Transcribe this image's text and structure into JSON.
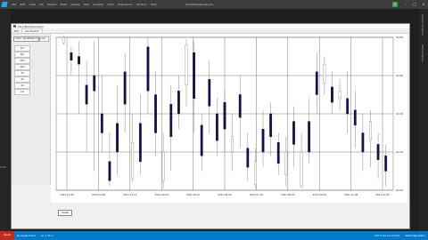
{
  "ide": {
    "title": "StockMarketAnalysis",
    "menu": [
      "File",
      "Edit",
      "View",
      "Git",
      "Project",
      "Build",
      "Debug",
      "Test",
      "Analyze",
      "Tools",
      "Extensions",
      "Window",
      "Help"
    ],
    "profile_initial": "A",
    "left_marker": "0:00",
    "right_tabs": [
      "Solution Explorer",
      "Team Explorer"
    ]
  },
  "app": {
    "title": "StockMarketAnalysis",
    "tabs": [
      "File",
      "Candlestick"
    ],
    "active_tab": "Candlestick",
    "symbol": "ticker: stockData.csv",
    "count_value": "1.00",
    "timeframes": [
      "1m",
      "5m",
      "15m",
      "30m",
      "1h",
      "4h",
      "1d",
      "1w"
    ],
    "close_label": "Close"
  },
  "status": {
    "ready_label": "Ready",
    "items": [
      "No issues found",
      "Ln: 1  Ch: 1"
    ],
    "right_items": [
      "Add to Source Control",
      "Select Repository"
    ]
  },
  "chart_data": {
    "type": "candlestick",
    "y_ticks": [
      "22.80",
      "22.60",
      "22.40",
      "22.20",
      "22.00"
    ],
    "x_ticks": [
      "2021-01-05",
      "2021-02-08",
      "2021-03-10",
      "2021-04-09",
      "2021-05-10",
      "2021-06-09",
      "2021-07-09",
      "2021-08-09",
      "2021-09-08",
      "2021-10-08",
      "2021-11-05"
    ],
    "ylim": [
      22.0,
      22.8
    ],
    "grid": true,
    "candles": [
      {
        "o": 22.8,
        "c": 22.77,
        "h": 22.81,
        "l": 22.76,
        "bull": false
      },
      {
        "o": 22.72,
        "c": 22.68,
        "h": 22.75,
        "l": 22.6,
        "bull": true
      },
      {
        "o": 22.7,
        "c": 22.66,
        "h": 22.78,
        "l": 22.4,
        "bull": true
      },
      {
        "o": 22.55,
        "c": 22.45,
        "h": 22.68,
        "l": 22.2,
        "bull": true
      },
      {
        "o": 22.6,
        "c": 22.52,
        "h": 22.78,
        "l": 22.1,
        "bull": true
      },
      {
        "o": 22.4,
        "c": 22.3,
        "h": 22.6,
        "l": 22.2,
        "bull": true
      },
      {
        "o": 22.15,
        "c": 22.05,
        "h": 22.3,
        "l": 22.02,
        "bull": true
      },
      {
        "o": 22.35,
        "c": 22.2,
        "h": 22.55,
        "l": 22.08,
        "bull": true
      },
      {
        "o": 22.62,
        "c": 22.45,
        "h": 22.72,
        "l": 22.3,
        "bull": true
      },
      {
        "o": 22.25,
        "c": 22.06,
        "h": 22.4,
        "l": 22.04,
        "bull": false
      },
      {
        "o": 22.35,
        "c": 22.15,
        "h": 22.5,
        "l": 22.08,
        "bull": true
      },
      {
        "o": 22.75,
        "c": 22.52,
        "h": 22.8,
        "l": 22.4,
        "bull": true
      },
      {
        "o": 22.5,
        "c": 22.3,
        "h": 22.62,
        "l": 22.18,
        "bull": true
      },
      {
        "o": 22.2,
        "c": 22.05,
        "h": 22.3,
        "l": 22.01,
        "bull": false
      },
      {
        "o": 22.45,
        "c": 22.28,
        "h": 22.55,
        "l": 22.1,
        "bull": true
      },
      {
        "o": 22.52,
        "c": 22.4,
        "h": 22.6,
        "l": 22.32,
        "bull": true
      },
      {
        "o": 22.76,
        "c": 22.55,
        "h": 22.79,
        "l": 22.44,
        "bull": false
      },
      {
        "o": 22.72,
        "c": 22.48,
        "h": 22.78,
        "l": 22.3,
        "bull": true
      },
      {
        "o": 22.34,
        "c": 22.18,
        "h": 22.4,
        "l": 22.1,
        "bull": true
      },
      {
        "o": 22.58,
        "c": 22.44,
        "h": 22.68,
        "l": 22.3,
        "bull": true
      },
      {
        "o": 22.4,
        "c": 22.26,
        "h": 22.48,
        "l": 22.18,
        "bull": true
      },
      {
        "o": 22.46,
        "c": 22.32,
        "h": 22.52,
        "l": 22.2,
        "bull": true
      },
      {
        "o": 22.28,
        "c": 22.2,
        "h": 22.4,
        "l": 22.1,
        "bull": false
      },
      {
        "o": 22.5,
        "c": 22.38,
        "h": 22.6,
        "l": 22.22,
        "bull": true
      },
      {
        "o": 22.22,
        "c": 22.12,
        "h": 22.3,
        "l": 22.05,
        "bull": true
      },
      {
        "o": 22.15,
        "c": 22.03,
        "h": 22.22,
        "l": 22.01,
        "bull": false
      },
      {
        "o": 22.32,
        "c": 22.2,
        "h": 22.42,
        "l": 22.12,
        "bull": true
      },
      {
        "o": 22.4,
        "c": 22.28,
        "h": 22.46,
        "l": 22.18,
        "bull": true
      },
      {
        "o": 22.25,
        "c": 22.14,
        "h": 22.3,
        "l": 22.08,
        "bull": true
      },
      {
        "o": 22.2,
        "c": 22.08,
        "h": 22.28,
        "l": 22.02,
        "bull": false
      },
      {
        "o": 22.36,
        "c": 22.24,
        "h": 22.44,
        "l": 22.12,
        "bull": true
      },
      {
        "o": 22.2,
        "c": 22.02,
        "h": 22.3,
        "l": 22.01,
        "bull": false
      },
      {
        "o": 22.36,
        "c": 22.2,
        "h": 22.48,
        "l": 22.14,
        "bull": true
      },
      {
        "o": 22.62,
        "c": 22.5,
        "h": 22.72,
        "l": 22.4,
        "bull": true
      },
      {
        "o": 22.66,
        "c": 22.56,
        "h": 22.7,
        "l": 22.5,
        "bull": false
      },
      {
        "o": 22.54,
        "c": 22.46,
        "h": 22.62,
        "l": 22.4,
        "bull": true
      },
      {
        "o": 22.52,
        "c": 22.48,
        "h": 22.58,
        "l": 22.42,
        "bull": false
      },
      {
        "o": 22.48,
        "c": 22.4,
        "h": 22.62,
        "l": 22.3,
        "bull": true
      },
      {
        "o": 22.42,
        "c": 22.34,
        "h": 22.52,
        "l": 22.22,
        "bull": true
      },
      {
        "o": 22.3,
        "c": 22.2,
        "h": 22.4,
        "l": 22.1,
        "bull": true
      },
      {
        "o": 22.36,
        "c": 22.26,
        "h": 22.42,
        "l": 22.12,
        "bull": false
      },
      {
        "o": 22.24,
        "c": 22.16,
        "h": 22.3,
        "l": 22.06,
        "bull": true
      },
      {
        "o": 22.18,
        "c": 22.1,
        "h": 22.24,
        "l": 22.02,
        "bull": true
      }
    ]
  }
}
